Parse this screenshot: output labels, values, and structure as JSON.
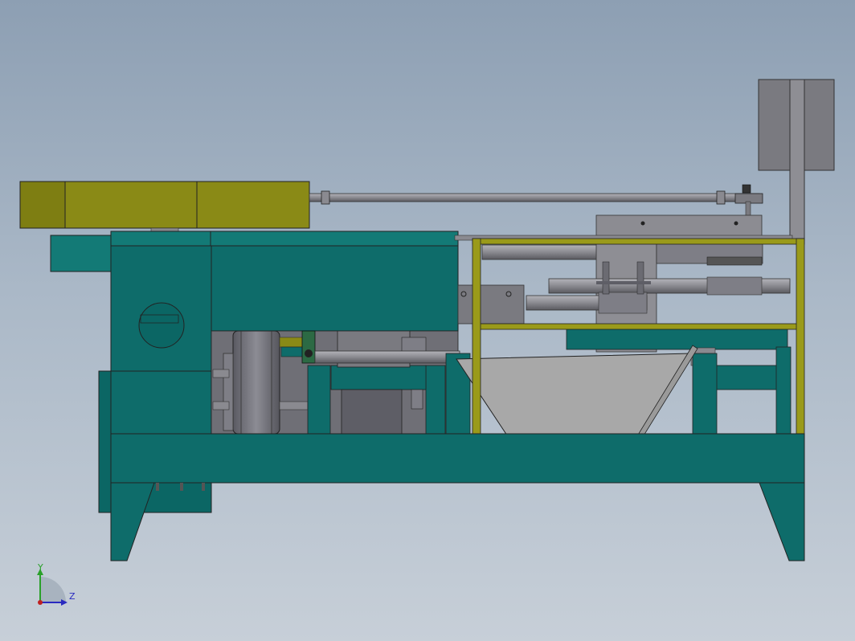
{
  "viewport": {
    "background_top": "#8d9fb3",
    "background_bottom": "#c7cfd8"
  },
  "colors": {
    "frame": "#0a6060",
    "frame_light": "#137a76",
    "motor": "#8a8a16",
    "guard_rail": "#9a9a1a",
    "steel": "#8a8a90",
    "steel_dark": "#6b6b72",
    "plate": "#9c9ca0",
    "hopper": "#a8a8a8"
  },
  "triad": {
    "x_axis_color": "#c02020",
    "y_axis_color": "#2aa02a",
    "z_axis_color": "#2a2ac0",
    "y_label": "Y",
    "z_label": "Z"
  },
  "components": [
    "frame-base",
    "drive-housing",
    "motor-gearbox",
    "flywheel",
    "belt-pulley",
    "hopper",
    "safety-rail",
    "control-box",
    "tie-rod"
  ]
}
